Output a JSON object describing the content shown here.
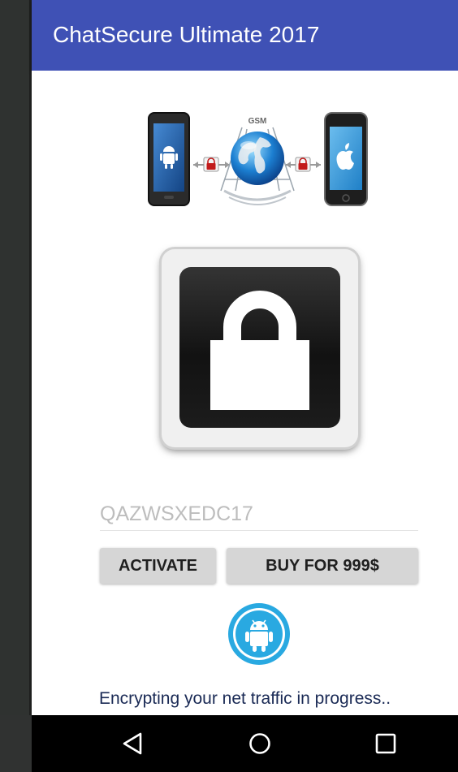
{
  "app": {
    "title": "ChatSecure Ultimate 2017"
  },
  "diagram": {
    "network_label": "GSM"
  },
  "activation": {
    "code_placeholder": "QAZWSXEDC17",
    "activate_label": "ACTIVATE",
    "buy_label": "BUY FOR 999$"
  },
  "status": {
    "message": "Encrypting your net traffic in progress.."
  },
  "icons": {
    "lock": "lock-icon",
    "android": "android-icon",
    "apple": "apple-icon",
    "globe": "globe-icon",
    "back": "back-triangle-icon",
    "home": "home-circle-icon",
    "recents": "recents-square-icon"
  },
  "colors": {
    "app_bar": "#3f51b5",
    "badge_blue": "#29a9e1",
    "button_bg": "#d6d6d6"
  }
}
